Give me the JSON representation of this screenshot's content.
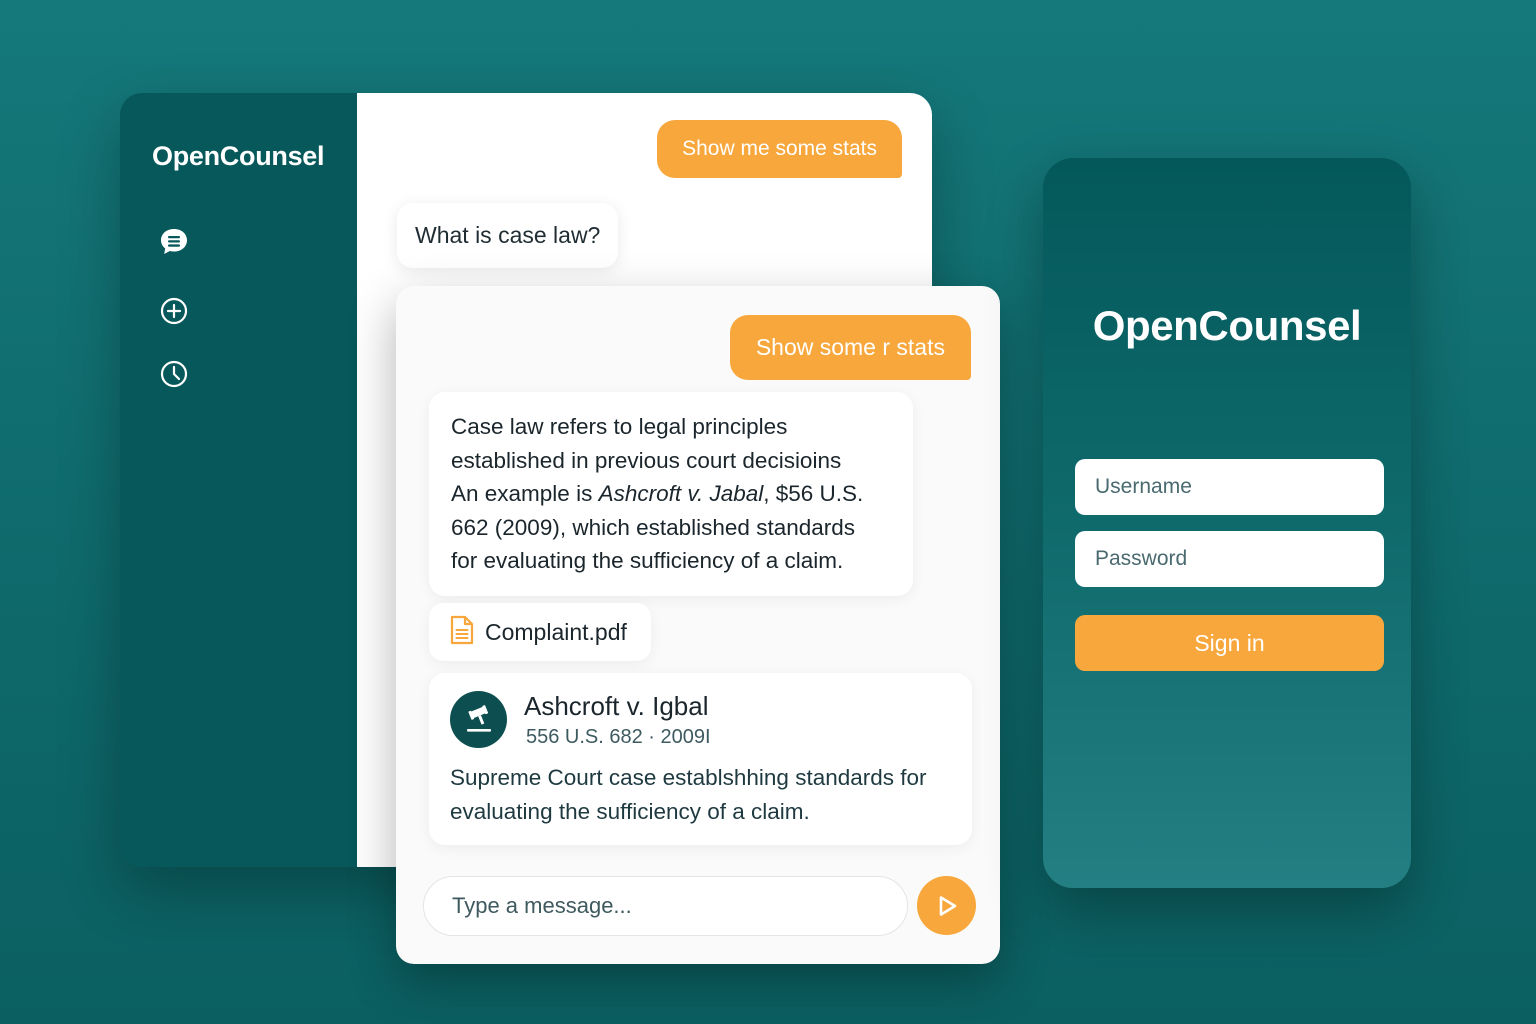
{
  "colors": {
    "background": "#0f6b6d",
    "sidebar": "#07585a",
    "accent": "#f7a73b",
    "card": "#ffffff"
  },
  "app": {
    "title": "OpenCounsel",
    "sidebar_icons": [
      "chat-icon",
      "plus-circle-icon",
      "clock-icon"
    ]
  },
  "back_chat": {
    "user_message": "Show me some stats",
    "bot_message": "What is case law?"
  },
  "front_chat": {
    "user_message": "Show some r stats",
    "answer": {
      "line1": "Case law refers to legal principles",
      "line2": "established in previous court decisioins",
      "line3_prefix": "An example is ",
      "line3_case": "Ashcroft v. Jabal",
      "line3_suffix": ", $56 U.S.",
      "line4": "662 (2009), which established standards",
      "line5": "for evaluating the sufficiency of a claim."
    },
    "attachment": {
      "icon": "pdf-file-icon",
      "name": "Complaint.pdf"
    },
    "case_card": {
      "icon": "gavel-icon",
      "title": "Ashcroft v. Igbal",
      "citation": "556 U.S. 682 · 2009I",
      "description": "Supreme Court case establshhing standards for evaluating the sufficiency of a claim."
    },
    "input_placeholder": "Type a message...",
    "send_icon": "send-icon"
  },
  "login": {
    "title": "OpenCounsel",
    "username_placeholder": "Username",
    "password_placeholder": "Password",
    "signin_label": "Sign in"
  }
}
